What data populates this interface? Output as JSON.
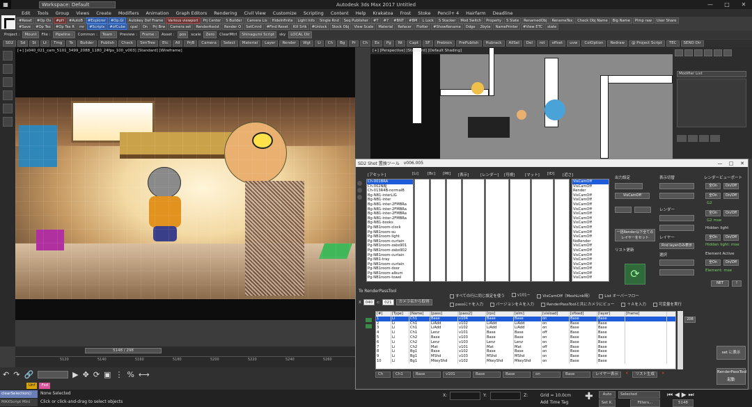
{
  "titlebar": {
    "workspace": "Workspace: Default",
    "app_title": "Autodesk 3ds Max 2017    Untitled"
  },
  "menu": [
    "Edit",
    "Tools",
    "Group",
    "Views",
    "Create",
    "Modifiers",
    "Animation",
    "Graph Editors",
    "Rendering",
    "Civil View",
    "Customize",
    "Scripting",
    "Content",
    "Help",
    "Krakatoa",
    "Frost",
    "Stoke",
    "Pencil+ 4",
    "Hairfarm",
    "Deadline"
  ],
  "toolbar1": [
    "#Reset",
    "#Op Ov",
    "#pH",
    "#AutoB",
    "#Explorer",
    "#Op.Gl",
    "Autokey Def Frame",
    "Various viewport",
    "Prj Center",
    "S Builder",
    "Camera Lis",
    "HideInfinite",
    "Light Info",
    "Single Rnd",
    "Seq Publisher",
    "#T",
    "#7",
    "#BNT",
    "#BM",
    "L Lock",
    "S Stacker",
    "Mod Switch",
    "Property",
    "S Slate",
    "RenamedObj",
    "RenameTex",
    "Check Obj Name",
    "Big Name",
    "Plmp raw",
    "User Share"
  ],
  "toolbar2": [
    "#Save",
    "#Op Tex",
    "#Op Tex R",
    "mr",
    "#Scripts",
    "#ofCube",
    "cpal",
    "On",
    "Prj Brw",
    "Camera set",
    "RenderAssist",
    "Render O",
    "SetCmrd",
    "#Find Reset",
    "Kill Srtk",
    "#Unlock",
    "Stock Obj",
    "View Scale",
    "Material",
    "Refacer",
    "Flotter",
    "#ShowRename",
    "Ddge",
    "2byte",
    "NamePrinter",
    "#View ETC",
    "state"
  ],
  "project_row": [
    "Project :",
    "Mount",
    "File :",
    "Pipeline :",
    "Common :",
    "Team :",
    "Preview :",
    "Frame :",
    "Asset :",
    "pos",
    "scale",
    "Zero",
    "ClearMtrl",
    "Shinagumi Script",
    "sky",
    "LOCAL Dir"
  ],
  "ribbon_row": [
    "SD2",
    "Sd",
    "St",
    "Lt",
    "Tmg",
    "To",
    "Builder",
    "Publish",
    "Check",
    "SimTree",
    "Etc",
    "All",
    "PrjB",
    "Camera",
    "Select",
    "Material",
    "Layer",
    "Render",
    "Wgt",
    "Li",
    "Ch",
    "Bg",
    "Pr",
    "Ch",
    "Ex",
    "Pg",
    "Nt",
    "Capt",
    "SF",
    "Prebisin",
    "PrePublish",
    "Hubrack",
    "AllSel",
    "Del",
    "rot",
    "offset",
    "uvw",
    "ColOption",
    "Redraw",
    "@ Project Script",
    "TEC",
    "SEND Dir"
  ],
  "viewport_left": {
    "label": "[+] [s040_021_cam_5101_3499_2088_1180_24fps_100_v003] [Standard] [Wireframe]"
  },
  "viewport_right": {
    "label": "[+] [Perspective] [Standard] [Default Shading]"
  },
  "modifier_list": "Modifier List",
  "timeline": {
    "frame": "5148 / 298",
    "ticks": [
      "5120",
      "5140",
      "5160",
      "5180",
      "5200",
      "5220",
      "5240",
      "5260",
      "5280"
    ]
  },
  "tags": [
    "Unf",
    "Fsd"
  ],
  "status": {
    "maxscript": "clearSelection()",
    "maxscript2": "MAXScript Mini",
    "selection": "None Selected",
    "prompt": "Click or click-and-drag to select objects",
    "x_label": "X:",
    "y_label": "Y:",
    "z_label": "Z:",
    "grid": "Grid = 10.0cm",
    "addtag": "Add Time Tag",
    "auto": "Auto",
    "setk": "Set K.",
    "selected": "Selected",
    "filters": "Filters...",
    "frame": "5148"
  },
  "tool": {
    "title": "SD2 Shot 置換ツール",
    "version": "v006.005",
    "headers": [
      "[アセット]",
      "[Li]",
      "[Bc]",
      "[Mt]",
      "[表示]",
      "[レンダー]",
      "[可視]",
      "[マット]",
      "[ID]",
      "[近さ]"
    ],
    "assets": [
      "Ch-001BRA",
      "Ch-002NBJ",
      "Ch-013R4B-normalB",
      "Bg-NB1-interLiG",
      "Bg-NB1-inter",
      "Bg-NB1-inter-2FMBRa",
      "Bg-NB1-inter-2FMBRa",
      "Bg-NB1-inter-2FMBRa",
      "Bg-NB1-inter-2FMBRa",
      "Bg-NB1-books",
      "Pg-NB1room-clock",
      "Pg-NB1room-su",
      "Pg-NB1room-light",
      "Pg-NB1room-curtain",
      "Pg-NB1room-zabs901",
      "Pg-NB1room-zabs902",
      "Pg-NB1room-curtain",
      "Pg-NB1-tray",
      "Pg-NB1room-curtain",
      "Pg-NB1room-door",
      "Pg-NB1room-album",
      "Pg-NB1room-towel"
    ],
    "viscam": [
      "VisCamOff",
      "VisCamOff",
      "Render",
      "VisCamOff",
      "VisCamOff",
      "VisCamOff",
      "VisCamOff",
      "VisCamOff",
      "VisCamOff",
      "VisCamOff",
      "VisCamOff",
      "VisCamOff",
      "VisCamOff",
      "NoRender",
      "VisCamOff",
      "VisCamOff",
      "VisCamOff",
      "VisCamOff",
      "VisCamOff",
      "VisCamOff",
      "VisCamOff",
      "VisCamOff"
    ],
    "options": {
      "output_settings": "出力設定",
      "display_toggle": "表示切替",
      "render_viewport": "レンダービューポート",
      "viscam_select": "VisCamOff",
      "render_label": "レンダー",
      "layer_label": "レイヤー",
      "list_update": "リスト更新",
      "g2": "G2",
      "g2_value": "G2 mse",
      "hidden_light": "Hidden light",
      "hidden_light_value": "Hidden light: mse",
      "element_active": "Element Active",
      "element_value": "Element: mse",
      "onoff": "On/Off",
      "on": "全On",
      "net": "NET",
      "batch_render": "一括Render以下全てのレイヤーをセット",
      "render_layer": "Rnd layerのみ表示",
      "select": "選択"
    },
    "renderpass_label": "To RenderPassTool",
    "fields": {
      "xlabel": "X",
      "x": "040",
      "c": "021",
      "apply_btn": "カメラ名から取得"
    },
    "checks": [
      "すべての行に同じ設定を使う",
      "v101~",
      "VisCamOff（MeshLink時）",
      "List オーバーフロー",
      "passに＋を入力",
      "バージョンをＡを入力",
      "RenderPassToolと共にカメラにビュー",
      "＋Ａを入力",
      "可変量を実行"
    ],
    "table_headers": [
      "[#]",
      "[Type]",
      "[Name]",
      "[pass]",
      "[pass2]",
      "[rps]",
      "[elm]",
      "[visload]",
      "[sfixed]",
      "[layer]",
      "[frame]"
    ],
    "table_rows": [
      [
        "1",
        "Li",
        "Ch1",
        "Base",
        "v104",
        "Base",
        "Base",
        "on",
        "Base",
        "Base",
        ""
      ],
      [
        "2",
        "Li",
        "Ch1",
        "LiAdd",
        "v102",
        "LiAdd",
        "LiAdd",
        "on",
        "Base",
        "Base",
        ""
      ],
      [
        "3",
        "Li",
        "Ch1",
        "LiAdd",
        "v102",
        "LiAdd",
        "LiAdd",
        "on",
        "Base",
        "Base",
        ""
      ],
      [
        "4",
        "Li",
        "Ch1",
        "Lenz",
        "v101",
        "Base",
        "Base",
        "off",
        "Base",
        "Base",
        ""
      ],
      [
        "5",
        "Li",
        "Ch2",
        "Base",
        "v103",
        "Base",
        "Base",
        "on",
        "Base",
        "Base",
        ""
      ],
      [
        "6",
        "Li",
        "Ch2",
        "Lenz",
        "v103",
        "Lenz",
        "Lenz",
        "on",
        "Base",
        "Base",
        ""
      ],
      [
        "7",
        "Li",
        "Ch2",
        "Mat",
        "v101",
        "Mat",
        "Mat",
        "off",
        "Base",
        "Base",
        ""
      ],
      [
        "8",
        "Li",
        "Bg1",
        "Base",
        "v102",
        "Base",
        "Base",
        "on",
        "Base",
        "Base",
        ""
      ],
      [
        "9",
        "Li",
        "Bg1",
        "MShd",
        "v103",
        "MShd",
        "MShd",
        "on",
        "Base",
        "Base",
        ""
      ],
      [
        "10",
        "Li",
        "Bg1",
        "MkeyShd",
        "v102",
        "MkeyShd",
        "MkeyShd",
        "on",
        "Base",
        "Base",
        ""
      ]
    ],
    "bottom": [
      "Ch",
      "Ch1",
      "Base",
      "v101",
      "Base",
      "Base",
      "on",
      "Base"
    ],
    "bottom_btn": "レイヤー表示",
    "bottom_btn2": "リスト生成",
    "side_value": "208",
    "side_btn1": "set に表示",
    "side_btn2": "RenderPassTool 起動"
  }
}
